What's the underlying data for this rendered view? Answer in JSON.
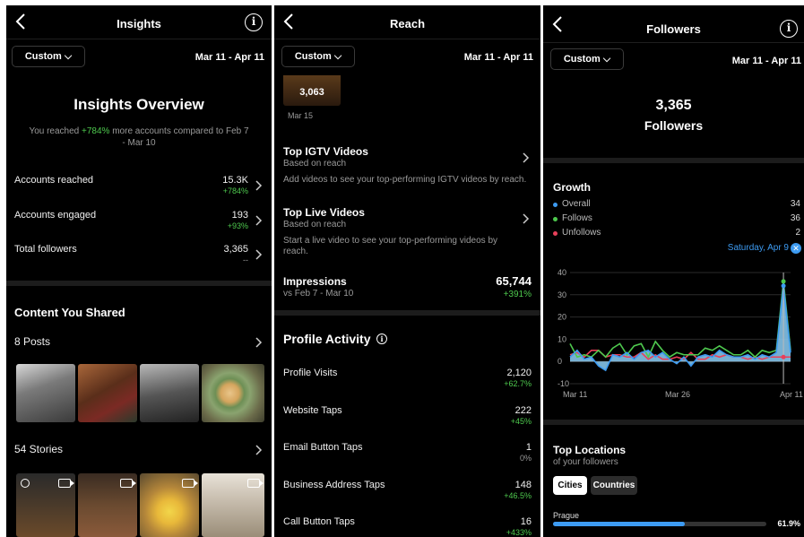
{
  "panel1": {
    "title": "Insights",
    "custom_label": "Custom",
    "date_range": "Mar 11 - Apr 11",
    "overview_title": "Insights Overview",
    "overview_pre": "You reached ",
    "overview_pct": "+784%",
    "overview_post": " more accounts compared to Feb 7",
    "overview_post2": "- Mar 10",
    "rows": [
      {
        "label": "Accounts reached",
        "value": "15.3K",
        "sub": "+784%"
      },
      {
        "label": "Accounts engaged",
        "value": "193",
        "sub": "+93%"
      },
      {
        "label": "Total followers",
        "value": "3,365",
        "sub": "--"
      }
    ],
    "content_title": "Content You Shared",
    "posts_label": "8 Posts",
    "stories_label": "54 Stories"
  },
  "panel2": {
    "title": "Reach",
    "custom_label": "Custom",
    "date_range": "Mar 11 - Apr 11",
    "story_value": "3,063",
    "story_date": "Mar 15",
    "igtv_title": "Top IGTV Videos",
    "igtv_sub": "Based on reach",
    "igtv_desc": "Add videos to see your top-performing IGTV videos by reach.",
    "live_title": "Top Live Videos",
    "live_sub": "Based on reach",
    "live_desc": "Start a live video to see your top-performing videos by reach.",
    "impressions_label": "Impressions",
    "impressions_value": "65,744",
    "impressions_sub": "vs Feb 7 - Mar 10",
    "impressions_pct": "+391%",
    "profile_activity_title": "Profile Activity",
    "activity": [
      {
        "label": "Profile Visits",
        "value": "2,120",
        "sub": "+62.7%",
        "color": "#4ec94e"
      },
      {
        "label": "Website Taps",
        "value": "222",
        "sub": "+45%",
        "color": "#4ec94e"
      },
      {
        "label": "Email Button Taps",
        "value": "1",
        "sub": "0%",
        "color": "#9a9a9a"
      },
      {
        "label": "Business Address Taps",
        "value": "148",
        "sub": "+46.5%",
        "color": "#4ec94e"
      },
      {
        "label": "Call Button Taps",
        "value": "16",
        "sub": "+433%",
        "color": "#4ec94e"
      }
    ]
  },
  "panel3": {
    "title": "Followers",
    "custom_label": "Custom",
    "date_range": "Mar 11 - Apr 11",
    "followers_count": "3,365",
    "followers_label": "Followers",
    "growth_title": "Growth",
    "legend": [
      {
        "label": "Overall",
        "value": "34",
        "color": "#3d9bf2"
      },
      {
        "label": "Follows",
        "value": "36",
        "color": "#4ec94e"
      },
      {
        "label": "Unfollows",
        "value": "2",
        "color": "#e8405a"
      }
    ],
    "selected_date": "Saturday, Apr 9",
    "locations_title": "Top Locations",
    "locations_sub": "of your followers",
    "tab_cities": "Cities",
    "tab_countries": "Countries",
    "city_name": "Prague",
    "city_pct": "61.9%",
    "city_fraction": 0.619,
    "accent_color": "#3d9bf2"
  },
  "chart_data": {
    "type": "line",
    "x_tick_labels": [
      "Mar 11",
      "Mar 26",
      "Apr 11"
    ],
    "y_ticks": [
      40,
      30,
      20,
      10,
      0,
      -10
    ],
    "ylim": [
      -10,
      40
    ],
    "series": [
      {
        "name": "Overall",
        "color": "#3d9bf2",
        "values": [
          2,
          5,
          1,
          2,
          -2,
          -4,
          3,
          2,
          4,
          1,
          4,
          5,
          2,
          4,
          1,
          -1,
          2,
          -2,
          2,
          3,
          2,
          5,
          3,
          2,
          2,
          3,
          1,
          3,
          2,
          4,
          34,
          4
        ]
      },
      {
        "name": "Follows",
        "color": "#4ec94e",
        "values": [
          8,
          2,
          3,
          2,
          5,
          2,
          6,
          8,
          3,
          7,
          8,
          2,
          9,
          5,
          2,
          4,
          3,
          3,
          3,
          6,
          5,
          7,
          5,
          3,
          3,
          5,
          2,
          5,
          4,
          5,
          36,
          5
        ]
      },
      {
        "name": "Unfollows",
        "color": "#e8405a",
        "values": [
          3,
          4,
          2,
          5,
          5,
          2,
          3,
          3,
          2,
          2,
          4,
          1,
          3,
          1,
          1,
          2,
          1,
          4,
          1,
          1,
          3,
          2,
          3,
          2,
          2,
          1,
          2,
          1,
          2,
          2,
          2,
          2
        ]
      }
    ]
  }
}
